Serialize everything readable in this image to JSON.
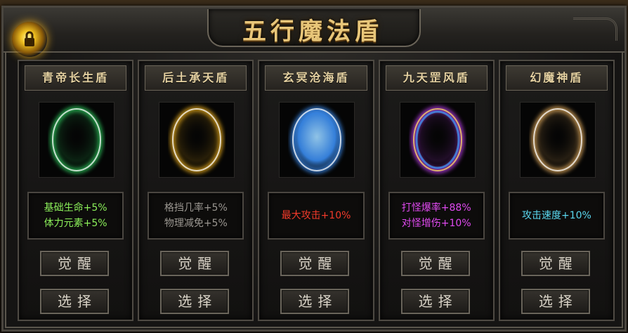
{
  "title": "五行魔法盾",
  "icons": {
    "corner_orb": "gold-orb-lock-icon"
  },
  "shields": [
    {
      "name": "青帝长生盾",
      "color": "#2fd060",
      "stats": [
        {
          "text": "基础生命+5%",
          "color": "#8cf05a"
        },
        {
          "text": "体力元素+5%",
          "color": "#8cf05a"
        }
      ],
      "awaken_label": "觉醒",
      "select_label": "选择"
    },
    {
      "name": "后土承天盾",
      "color": "#f2b21a",
      "stats": [
        {
          "text": "格挡几率+5%",
          "color": "#9a9690"
        },
        {
          "text": "物理减免+5%",
          "color": "#9a9690"
        }
      ],
      "awaken_label": "觉醒",
      "select_label": "选择"
    },
    {
      "name": "玄冥沧海盾",
      "color": "#3a8cf0",
      "stats": [
        {
          "text": "最大攻击+10%",
          "color": "#f23a2a"
        }
      ],
      "awaken_label": "觉醒",
      "select_label": "选择"
    },
    {
      "name": "九天罡风盾",
      "color": "#c040f0",
      "stats": [
        {
          "text": "打怪爆率+88%",
          "color": "#e04af0"
        },
        {
          "text": "对怪增伤+10%",
          "color": "#e04af0"
        }
      ],
      "awaken_label": "觉醒",
      "select_label": "选择"
    },
    {
      "name": "幻魔神盾",
      "color": "#e8b060",
      "stats": [
        {
          "text": "攻击速度+10%",
          "color": "#5ad8f0"
        }
      ],
      "awaken_label": "觉醒",
      "select_label": "选择"
    }
  ]
}
